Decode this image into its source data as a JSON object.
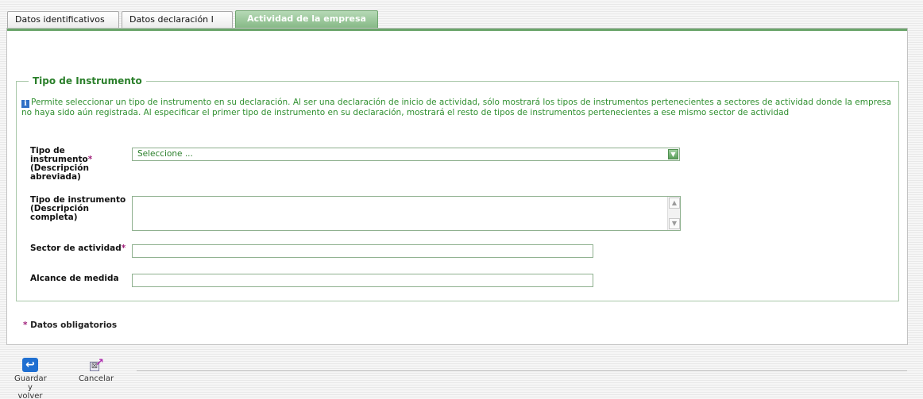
{
  "tabs": [
    {
      "label": "Datos identificativos",
      "active": false
    },
    {
      "label": "Datos declaración I",
      "active": false
    },
    {
      "label": "Actividad de la empresa",
      "active": true
    }
  ],
  "section": {
    "legend": "Tipo de Instrumento",
    "info_text": "Permite seleccionar un tipo de instrumento en su declaración. Al ser una declaración de inicio de actividad, sólo mostrará los tipos de instrumentos pertenecientes a sectores de actividad donde la empresa no haya sido aún registrada. Al especificar el primer tipo de instrumento en su declaración, mostrará el resto de tipos de instrumentos pertenecientes a ese mismo sector de actividad",
    "info_icon": "info-icon"
  },
  "fields": {
    "tipo_abreviada": {
      "label_part1": "Tipo de instrumento",
      "label_part2": "(Descripción abreviada)",
      "required_mark": "*",
      "selected_value": "Seleccione ..."
    },
    "tipo_completa": {
      "label": "Tipo de instrumento (Descripción completa)",
      "value": ""
    },
    "sector": {
      "label": "Sector de actividad",
      "required_mark": "*",
      "value": ""
    },
    "alcance": {
      "label": "Alcance de medida",
      "value": ""
    }
  },
  "required_note": {
    "mark": "*",
    "text": "Datos obligatorios"
  },
  "actions": {
    "save_label": "Guardar y volver",
    "cancel_label": "Cancelar"
  },
  "colors": {
    "accent_green": "#6aa56a",
    "active_tab": "#86b986",
    "info_text": "#2f8f2f",
    "required_mark": "#a0207a"
  }
}
